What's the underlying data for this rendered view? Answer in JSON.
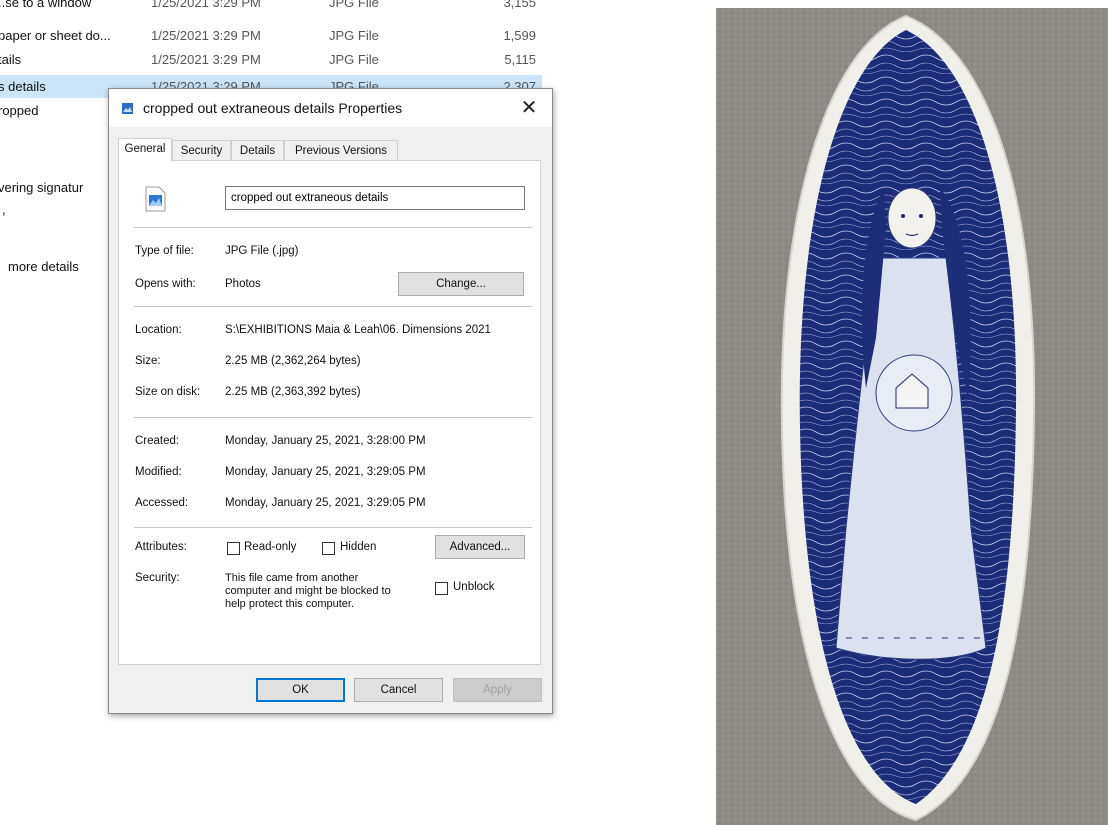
{
  "file_list": {
    "rows": [
      {
        "name": "..se to a window",
        "date": "1/25/2021 3:29 PM",
        "type": "JPG File",
        "size": "3,155",
        "selected": false
      },
      {
        "name": "paper or sheet do...",
        "date": "1/25/2021 3:29 PM",
        "type": "JPG File",
        "size": "1,599",
        "selected": false
      },
      {
        "name": "tails",
        "date": "1/25/2021 3:29 PM",
        "type": "JPG File",
        "size": "5,115",
        "selected": false
      },
      {
        "name": "s details",
        "date": "1/25/2021 3:29 PM",
        "type": "JPG File",
        "size": "2,307",
        "selected": true
      },
      {
        "name": "ropped",
        "date": "",
        "type": "",
        "size": "",
        "selected": false
      },
      {
        "name": "",
        "date": "",
        "type": "",
        "size": "",
        "selected": false
      },
      {
        "name": "",
        "date": "",
        "type": "",
        "size": "",
        "selected": false
      },
      {
        "name": "vering signatur",
        "date": "",
        "type": "",
        "size": "",
        "selected": false
      },
      {
        "name": "",
        "date": "",
        "type": "",
        "size": "",
        "selected": false
      },
      {
        "name": "",
        "date": "",
        "type": "",
        "size": "",
        "selected": false
      },
      {
        "name": "more details",
        "date": "",
        "type": "",
        "size": "",
        "selected": false
      }
    ]
  },
  "dialog": {
    "title": "cropped out extraneous details Properties",
    "close_glyph": "✕",
    "tabs": [
      "General",
      "Security",
      "Details",
      "Previous Versions"
    ],
    "active_tab": "General",
    "file_name": "cropped out extraneous details",
    "type_label": "Type of file:",
    "type_value": "JPG File (.jpg)",
    "opens_label": "Opens with:",
    "opens_value": "Photos",
    "change_button": "Change...",
    "location_label": "Location:",
    "location_value": "S:\\EXHIBITIONS Maia & Leah\\06. Dimensions 2021",
    "size_label": "Size:",
    "size_value": "2.25 MB (2,362,264 bytes)",
    "size_disk_label": "Size on disk:",
    "size_disk_value": "2.25 MB (2,363,392 bytes)",
    "created_label": "Created:",
    "created_value": "Monday, January 25, 2021, 3:28:00 PM",
    "modified_label": "Modified:",
    "modified_value": "Monday, January 25, 2021, 3:29:05 PM",
    "accessed_label": "Accessed:",
    "accessed_value": "Monday, January 25, 2021, 3:29:05 PM",
    "attributes_label": "Attributes:",
    "readonly_label": "Read-only",
    "hidden_label": "Hidden",
    "advanced_button": "Advanced...",
    "security_label": "Security:",
    "security_line1": "This file came from another",
    "security_line2": "computer and might be blocked to",
    "security_line3": "help protect this computer.",
    "unblock_label": "Unblock",
    "ok_button": "OK",
    "cancel_button": "Cancel",
    "apply_button": "Apply"
  },
  "colors": {
    "accent": "#0078d7",
    "selection": "#cce4f7",
    "bowl_blue": "#1f2f7a"
  }
}
